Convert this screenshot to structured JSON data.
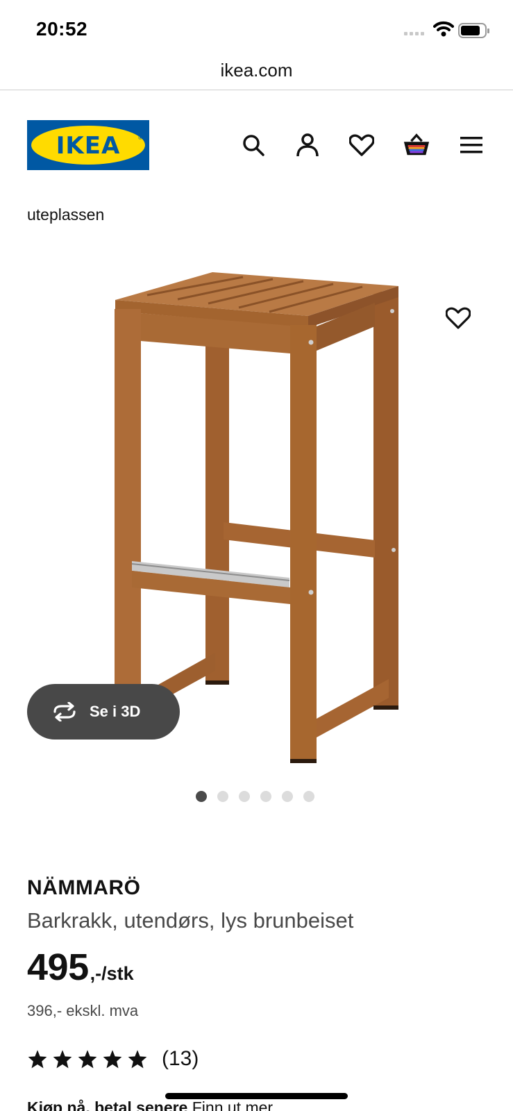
{
  "status_bar": {
    "time": "20:52"
  },
  "browser": {
    "url": "ikea.com"
  },
  "header": {
    "logo_text": "IKEA",
    "icons": [
      "search-icon",
      "account-icon",
      "heart-icon",
      "basket-icon",
      "menu-icon"
    ]
  },
  "breadcrumb": "uteplassen",
  "gallery": {
    "view_3d_label": "Se i 3D",
    "slide_count": 6,
    "active_slide": 1
  },
  "product": {
    "name": "NÄMMARÖ",
    "description": "Barkrakk, utendørs, lys brunbeiset",
    "price": "495",
    "price_suffix": ",-/stk",
    "price_ex_vat": "396,- ekskl. mva",
    "rating": 5,
    "review_count": "(13)"
  },
  "finance": {
    "bold": "Kjøp nå, betal senere",
    "link": "Finn ut mer"
  },
  "colors": {
    "ikea_blue": "#0058a3",
    "ikea_yellow": "#ffdb00",
    "wood": "#a9683a",
    "button_3d_bg": "#484848"
  }
}
